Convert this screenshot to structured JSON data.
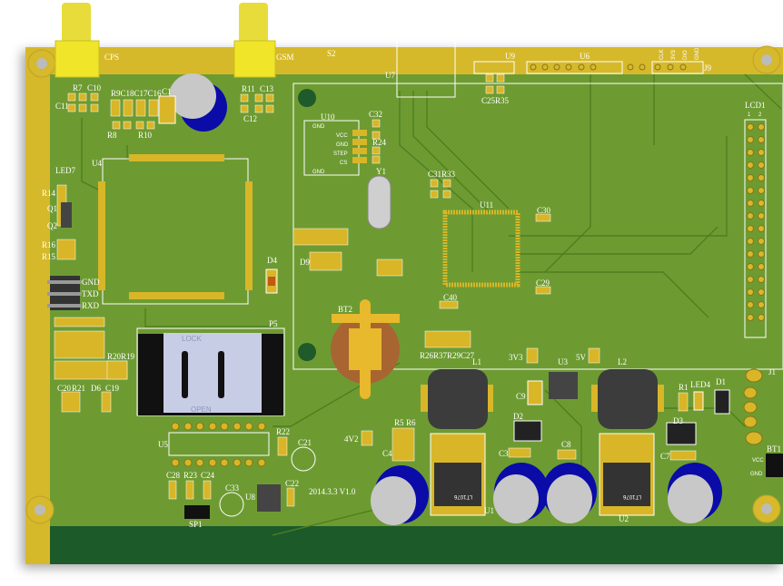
{
  "colors": {
    "board_green": "#6d9b30",
    "gold_edge": "#d6b92c",
    "bottom_strip": "#1f5a2a",
    "silkscreen": "#ffffff",
    "capacitor_blue": "#0b0ba8",
    "connector_yellow": "#f1e52a"
  },
  "connectors": {
    "gps": "CPS",
    "gsm": "GSM"
  },
  "labels": {
    "s2": "S2",
    "u7": "U7",
    "u9": "U9",
    "u6": "U6",
    "j9": "J9",
    "j9_pins": [
      "CLK",
      "3V3",
      "DIO",
      "GND"
    ],
    "r7": "R7",
    "c10": "C10",
    "c11": "C11",
    "r9c18c17c16": "R9C18C17C16",
    "c1": "C1",
    "r11": "R11",
    "c13": "C13",
    "c12": "C12",
    "r8": "R8",
    "r10": "R10",
    "u10": "U10",
    "u10_pins": [
      "GND",
      "VCC",
      "GND",
      "STEP",
      "CS",
      "GND"
    ],
    "c32": "C32",
    "r24": "R24",
    "y1": "Y1",
    "c31r33": "C31R33",
    "u11": "U11",
    "c30": "C30",
    "lcd1": "LCD1",
    "lcd_pin1": "1",
    "lcd_pin2": "2",
    "c25r35": "C25R35",
    "u4": "U4",
    "led7": "LED7",
    "r14": "R14",
    "q1": "Q1",
    "q2": "Q2",
    "r16": "R16",
    "r15": "R15",
    "d4": "D4",
    "d9": "D9",
    "c40": "C40",
    "c29": "C29",
    "serial_pins": [
      "GND",
      "TXD",
      "RXD"
    ],
    "p5": "P5",
    "sim_lock": "LOCK",
    "sim_open": "OPEN",
    "r20r19": "R20R19",
    "c20": "C20",
    "r21": "R21",
    "d6": "D6",
    "c19": "C19",
    "u5": "U5",
    "r22": "R22",
    "c21": "C21",
    "v4v2": "4V2",
    "c28": "C28",
    "r23": "R23",
    "c24": "C24",
    "c33": "C33",
    "u8": "U8",
    "c22": "C22",
    "sp1": "SP1",
    "version": "2014.3.3  V1.0",
    "bt2": "BT2",
    "r26r37r29c27": "R26R37R29C27",
    "l1": "L1",
    "v3v3": "3V3",
    "u3": "U3",
    "v5": "5V",
    "l2": "L2",
    "c9": "C9",
    "d2": "D2",
    "c3": "C3",
    "c8": "C8",
    "r5": "R5",
    "r6": "R6",
    "c4": "C4",
    "u1": "U1",
    "u2": "U2",
    "r1": "R1",
    "led4": "LED4",
    "d1": "D1",
    "d3": "D3",
    "c7": "C7",
    "j1": "J1",
    "bt1": "BT1",
    "bt1_vcc": "VCC",
    "bt1_gnd": "GND",
    "regulator_marking": "LT1076"
  }
}
